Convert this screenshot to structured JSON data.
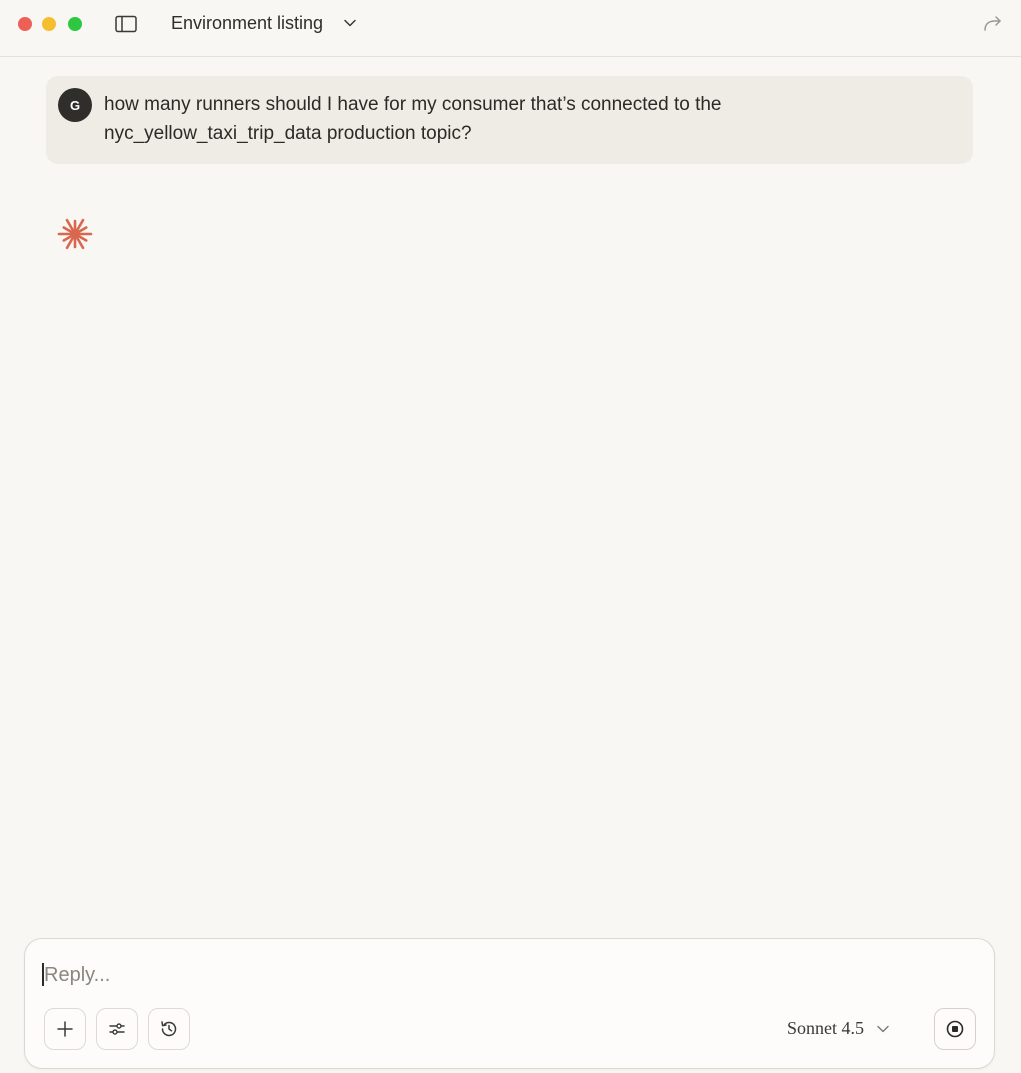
{
  "window": {
    "title": "Environment listing"
  },
  "conversation": {
    "user": {
      "avatar_initial": "G",
      "message": "how many runners should I have for my consumer that’s connected to the nyc_yellow_taxi_trip_data production topic?"
    },
    "assistant": {
      "status_icon": "spark-icon",
      "accent_color": "#d9674f"
    }
  },
  "composer": {
    "placeholder": "Reply...",
    "model_label": "Sonnet 4.5",
    "icons": [
      "plus-icon",
      "sliders-icon",
      "history-icon",
      "chevron-down-icon",
      "stop-icon"
    ]
  }
}
